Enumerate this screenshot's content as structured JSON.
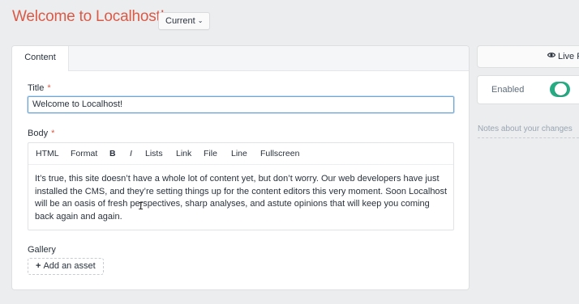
{
  "page": {
    "title": "Welcome to Localhost!",
    "revision_label": "Current"
  },
  "tabs": [
    {
      "label": "Content"
    }
  ],
  "fields": {
    "title": {
      "label": "Title",
      "required_mark": "*",
      "value": "Welcome to Localhost!"
    },
    "body": {
      "label": "Body",
      "required_mark": "*",
      "toolbar": [
        "HTML",
        "Format",
        "B",
        "I",
        "Lists",
        "Link",
        "File",
        "Line",
        "Fullscreen"
      ],
      "text": "It’s true, this site doesn’t have a whole lot of content yet, but don’t worry. Our web developers have just installed the CMS, and they’re setting things up for the content editors this very moment. Soon Localhost will be an oasis of fresh perspectives, sharp analyses, and astute opinions that will keep you coming back again and again."
    },
    "gallery": {
      "label": "Gallery",
      "add_button": "Add an asset"
    }
  },
  "sidebar": {
    "live_preview": "Live P",
    "enabled_label": "Enabled",
    "enabled": true,
    "notes_placeholder": "Notes about your changes"
  },
  "colors": {
    "title_red": "#da5a47",
    "toggle_green": "#27ab83",
    "focus_blue": "#6ea7d6"
  },
  "icons": [
    "chevron-down-icon",
    "plus-icon",
    "eye-icon",
    "text-cursor-icon"
  ]
}
